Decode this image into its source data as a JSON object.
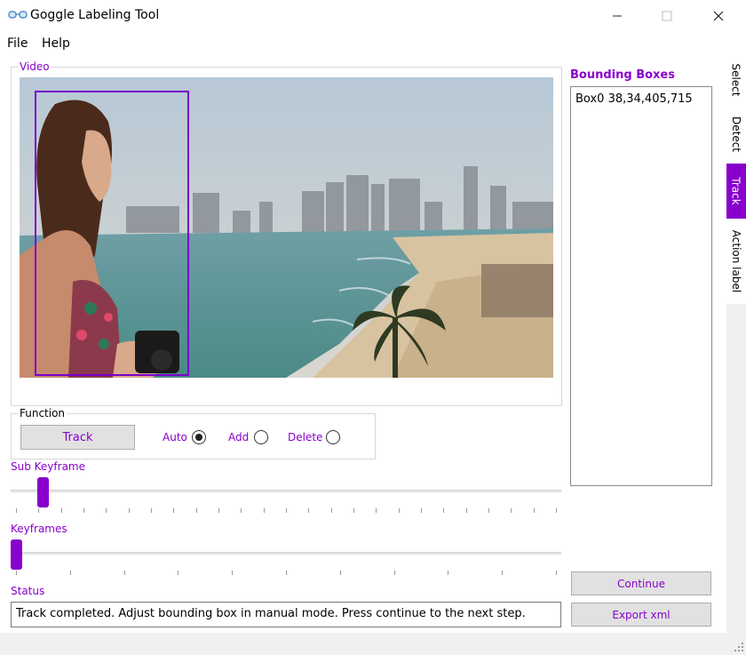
{
  "window": {
    "title": "Goggle Labeling Tool",
    "minimize": "—",
    "maximize": "☐",
    "close": "✕",
    "icon": "goggles-icon"
  },
  "menu": {
    "items": [
      "File",
      "Help"
    ]
  },
  "video_group": {
    "title": "Video"
  },
  "function_group": {
    "title": "Function",
    "track_button": "Track",
    "radios": [
      {
        "label": "Auto",
        "checked": true
      },
      {
        "label": "Add",
        "checked": false
      },
      {
        "label": "Delete",
        "checked": false
      }
    ]
  },
  "sub_keyframe": {
    "label": "Sub Keyframe",
    "value_fraction": 0.05
  },
  "keyframes": {
    "label": "Keyframes",
    "value_fraction": 0.0
  },
  "status": {
    "label": "Status",
    "text": "Track completed. Adjust bounding box in manual mode. Press continue to the next step."
  },
  "bounding_boxes": {
    "title": "Bounding Boxes",
    "items": [
      "Box0 38,34,405,715"
    ]
  },
  "buttons": {
    "continue": "Continue",
    "export": "Export xml"
  },
  "tabs": [
    {
      "label": "Select",
      "active": false
    },
    {
      "label": "Detect",
      "active": false
    },
    {
      "label": "Track",
      "active": true
    },
    {
      "label": "Action label",
      "active": false
    }
  ],
  "colors": {
    "accent": "#8800cc"
  }
}
